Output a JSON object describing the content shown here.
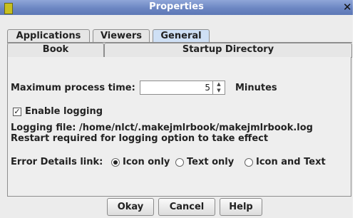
{
  "window": {
    "title": "Properties"
  },
  "tabs_row1": [
    {
      "label": "Applications",
      "selected": false
    },
    {
      "label": "Viewers",
      "selected": false
    },
    {
      "label": "General",
      "selected": true
    }
  ],
  "tabs_row2": [
    {
      "label": "Book"
    },
    {
      "label": "Startup Directory"
    }
  ],
  "general": {
    "max_process_label": "Maximum process time:",
    "max_process_value": "5",
    "max_process_unit": "Minutes",
    "enable_logging_label": "Enable logging",
    "enable_logging_checked": true,
    "logging_file_text": "Logging file: /home/nlct/.makejmlrbook/makejmlrbook.log",
    "restart_text": "Restart required for logging option to take effect",
    "error_details_label": "Error Details link:",
    "error_options": [
      {
        "label": "Icon only",
        "selected": true
      },
      {
        "label": "Text only",
        "selected": false
      },
      {
        "label": "Icon and Text",
        "selected": false
      }
    ]
  },
  "buttons": {
    "okay": "Okay",
    "cancel": "Cancel",
    "help": "Help"
  },
  "icons": {
    "window_icon": "app-icon",
    "close": "close-icon",
    "spinner_up": "chevron-up-icon",
    "spinner_down": "chevron-down-icon"
  }
}
